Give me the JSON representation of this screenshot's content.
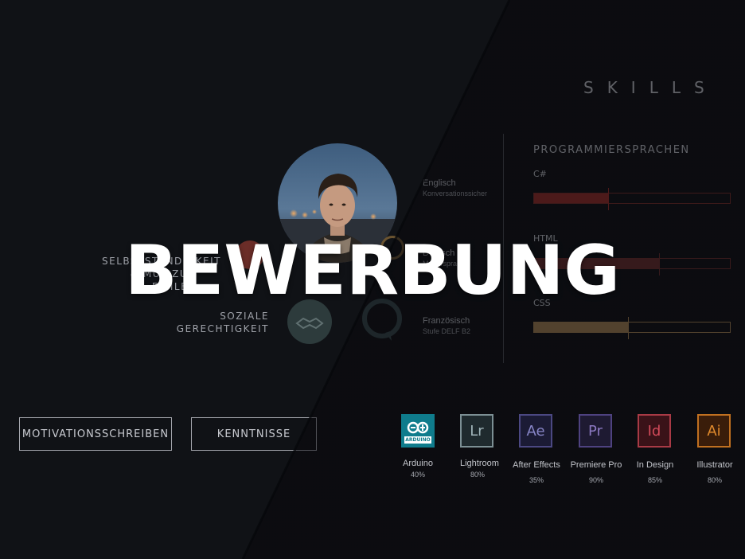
{
  "skills_title": "SKILLS",
  "programming": {
    "title": "PROGRAMMIERSPRACHEN",
    "languages": [
      {
        "name": "C#",
        "percent": 38,
        "color": "#9b2b26"
      },
      {
        "name": "HTML",
        "percent": 64,
        "color": "#6b2b2a"
      },
      {
        "name": "CSS",
        "percent": 48,
        "color": "#a88453"
      }
    ]
  },
  "spoken_languages": [
    {
      "name": "Englisch",
      "level": "Konversationssicher"
    },
    {
      "name": "Deutsch",
      "level": "Muttersprache"
    },
    {
      "name": "Französisch",
      "level": "Stufe DELF B2"
    }
  ],
  "values": [
    {
      "label": "SELBSTSTÄNDIGKEIT & MUT ZUR FEHLER"
    },
    {
      "label": "SOZIALE GERECHTIGKEIT"
    }
  ],
  "nav": {
    "motivation": "MOTIVATIONSSCHREIBEN",
    "kenntnisse": "KENNTNISSE"
  },
  "apps": [
    {
      "name": "Arduino",
      "percent": "40%",
      "abbr": "ARDUINO",
      "bg": "#0f7c8c",
      "fg": "#ffffff",
      "border": "#0f7c8c"
    },
    {
      "name": "Lightroom",
      "percent": "80%",
      "abbr": "Lr",
      "bg": "#1f2a2e",
      "fg": "#9fb3b8",
      "border": "#7c8f94"
    },
    {
      "name": "After Effects",
      "percent": "35%",
      "abbr": "Ae",
      "bg": "#1b1b35",
      "fg": "#8785c6",
      "border": "#4b4882"
    },
    {
      "name": "Premiere Pro",
      "percent": "90%",
      "abbr": "Pr",
      "bg": "#1e1a32",
      "fg": "#8b78c0",
      "border": "#4e4280"
    },
    {
      "name": "In Design",
      "percent": "85%",
      "abbr": "Id",
      "bg": "#3a1218",
      "fg": "#d24a5a",
      "border": "#a83a45"
    },
    {
      "name": "Illustrator",
      "percent": "80%",
      "abbr": "Ai",
      "bg": "#3a1d0a",
      "fg": "#e08a2c",
      "border": "#c07020"
    }
  ],
  "hero_title": "BEWERBUNG"
}
